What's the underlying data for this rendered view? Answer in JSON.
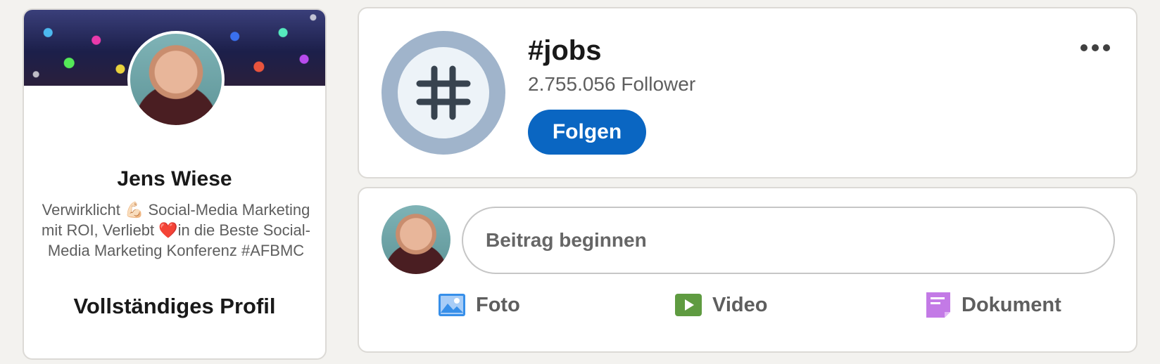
{
  "profile": {
    "name": "Jens Wiese",
    "headline": "Verwirklicht 💪🏻 Social-Media Marketing mit ROI, Verliebt ❤️in die Beste Social-Media Marketing Konferenz #AFBMC",
    "full_profile_link": "Vollständiges Profil"
  },
  "hashtag": {
    "title": "#jobs",
    "followers": "2.755.056 Follower",
    "follow_label": "Folgen",
    "more_icon": "ellipsis-icon"
  },
  "share_box": {
    "placeholder": "Beitrag beginnen",
    "actions": [
      {
        "label": "Foto",
        "icon": "photo-icon",
        "color": "#378fe9"
      },
      {
        "label": "Video",
        "icon": "video-icon",
        "color": "#5f9b41"
      },
      {
        "label": "Dokument",
        "icon": "document-icon",
        "color": "#c37ae6"
      }
    ]
  },
  "colors": {
    "brand_blue": "#0a66c2",
    "background": "#f3f2ef",
    "hashtag_ring": "#a0b4cb"
  }
}
